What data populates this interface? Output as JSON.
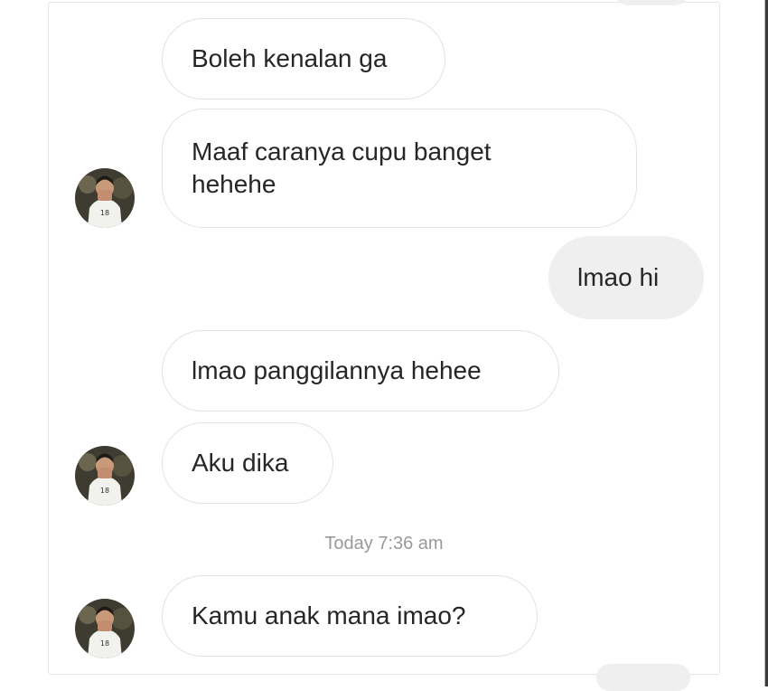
{
  "messages": [
    {
      "direction": "incoming",
      "text": "Boleh kenalan ga"
    },
    {
      "direction": "incoming",
      "text": "Maaf caranya cupu banget hehehe"
    },
    {
      "direction": "outgoing",
      "text": "lmao hi"
    },
    {
      "direction": "incoming",
      "text": "lmao panggilannya hehee"
    },
    {
      "direction": "incoming",
      "text": "Aku dika"
    },
    {
      "direction": "incoming",
      "text": "Kamu anak mana imao?"
    }
  ],
  "timestamp": "Today 7:36 am",
  "colors": {
    "incoming_bg": "#ffffff",
    "incoming_border": "#e3e3e3",
    "outgoing_bg": "#efefef",
    "text": "#262626",
    "timestamp": "#999999"
  },
  "icons": {
    "avatar": "contact-avatar"
  }
}
